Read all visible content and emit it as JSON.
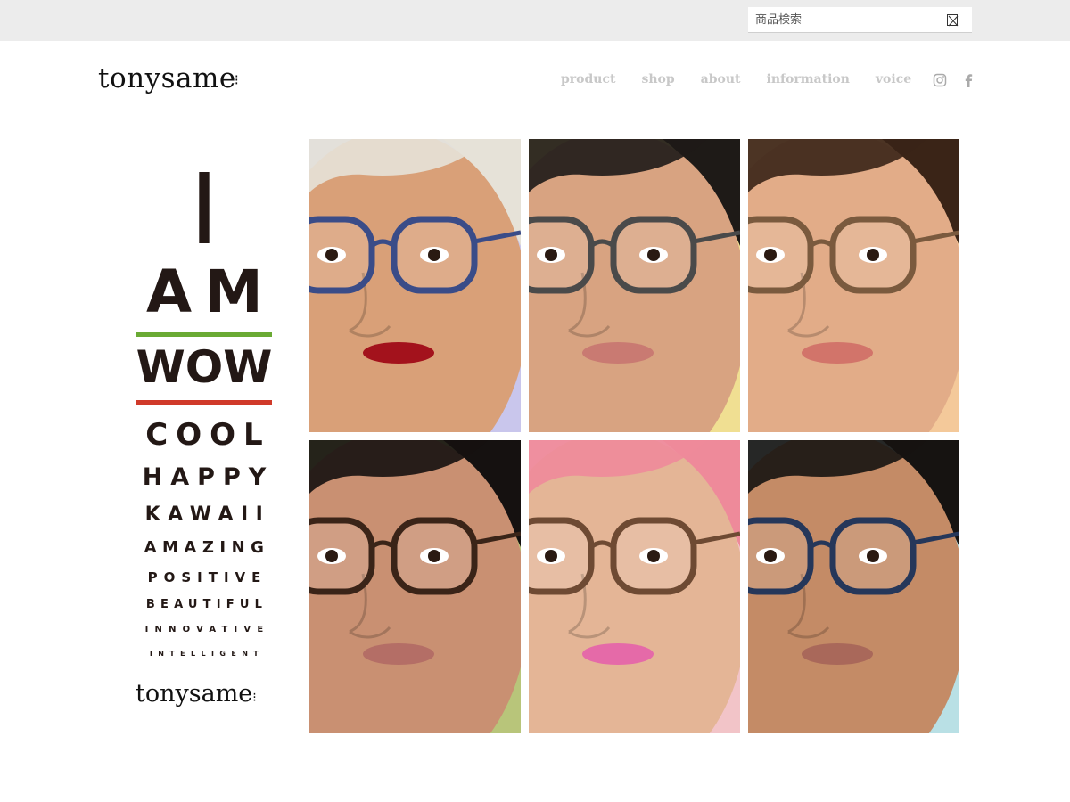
{
  "search": {
    "placeholder": "商品検索"
  },
  "header": {
    "logo_text": "tonysame",
    "nav": [
      "product",
      "shop",
      "about",
      "information",
      "voice"
    ]
  },
  "social_icons": [
    "instagram-icon",
    "facebook-icon"
  ],
  "hero_words": {
    "i": "I",
    "am": "AM",
    "wow": "WOW",
    "cool": "COOL",
    "happy": "HAPPY",
    "kawaii": "KAWAII",
    "amazing": "AMAZING",
    "positive": "POSITIVE",
    "beautiful": "BEAUTIFUL",
    "innovative": "INNOVATIVE",
    "intelligent": "INTELLIGENT",
    "brand": "tonysame"
  },
  "colors": {
    "green_line": "#6aaa34",
    "red_line": "#d03a2a",
    "text_dark": "#231815",
    "nav_gray": "#c8c8c8",
    "topbar_bg": "#ececec"
  },
  "portraits": [
    {
      "bg": "#c9c6ec",
      "skin": "#d9a078",
      "hair": "#e6e2d8",
      "frame": "#3a4c88",
      "lips": "#a3121c"
    },
    {
      "bg": "#f0df92",
      "skin": "#d8a381",
      "hair": "#1e1a17",
      "frame": "#4a4a4a",
      "lips": "#c97a72"
    },
    {
      "bg": "#f4c99a",
      "skin": "#e2ac88",
      "hair": "#3a2417",
      "frame": "#7a5a3e",
      "lips": "#d2746a"
    },
    {
      "bg": "#b8c57a",
      "skin": "#c99072",
      "hair": "#151110",
      "frame": "#3a2418",
      "lips": "#b46e66"
    },
    {
      "bg": "#f2c4c8",
      "skin": "#e4b596",
      "hair": "#ee8a9a",
      "frame": "#6e4a33",
      "lips": "#e56aa8"
    },
    {
      "bg": "#b9e0e5",
      "skin": "#c48b66",
      "hair": "#161311",
      "frame": "#25375a",
      "lips": "#a9685a"
    }
  ]
}
